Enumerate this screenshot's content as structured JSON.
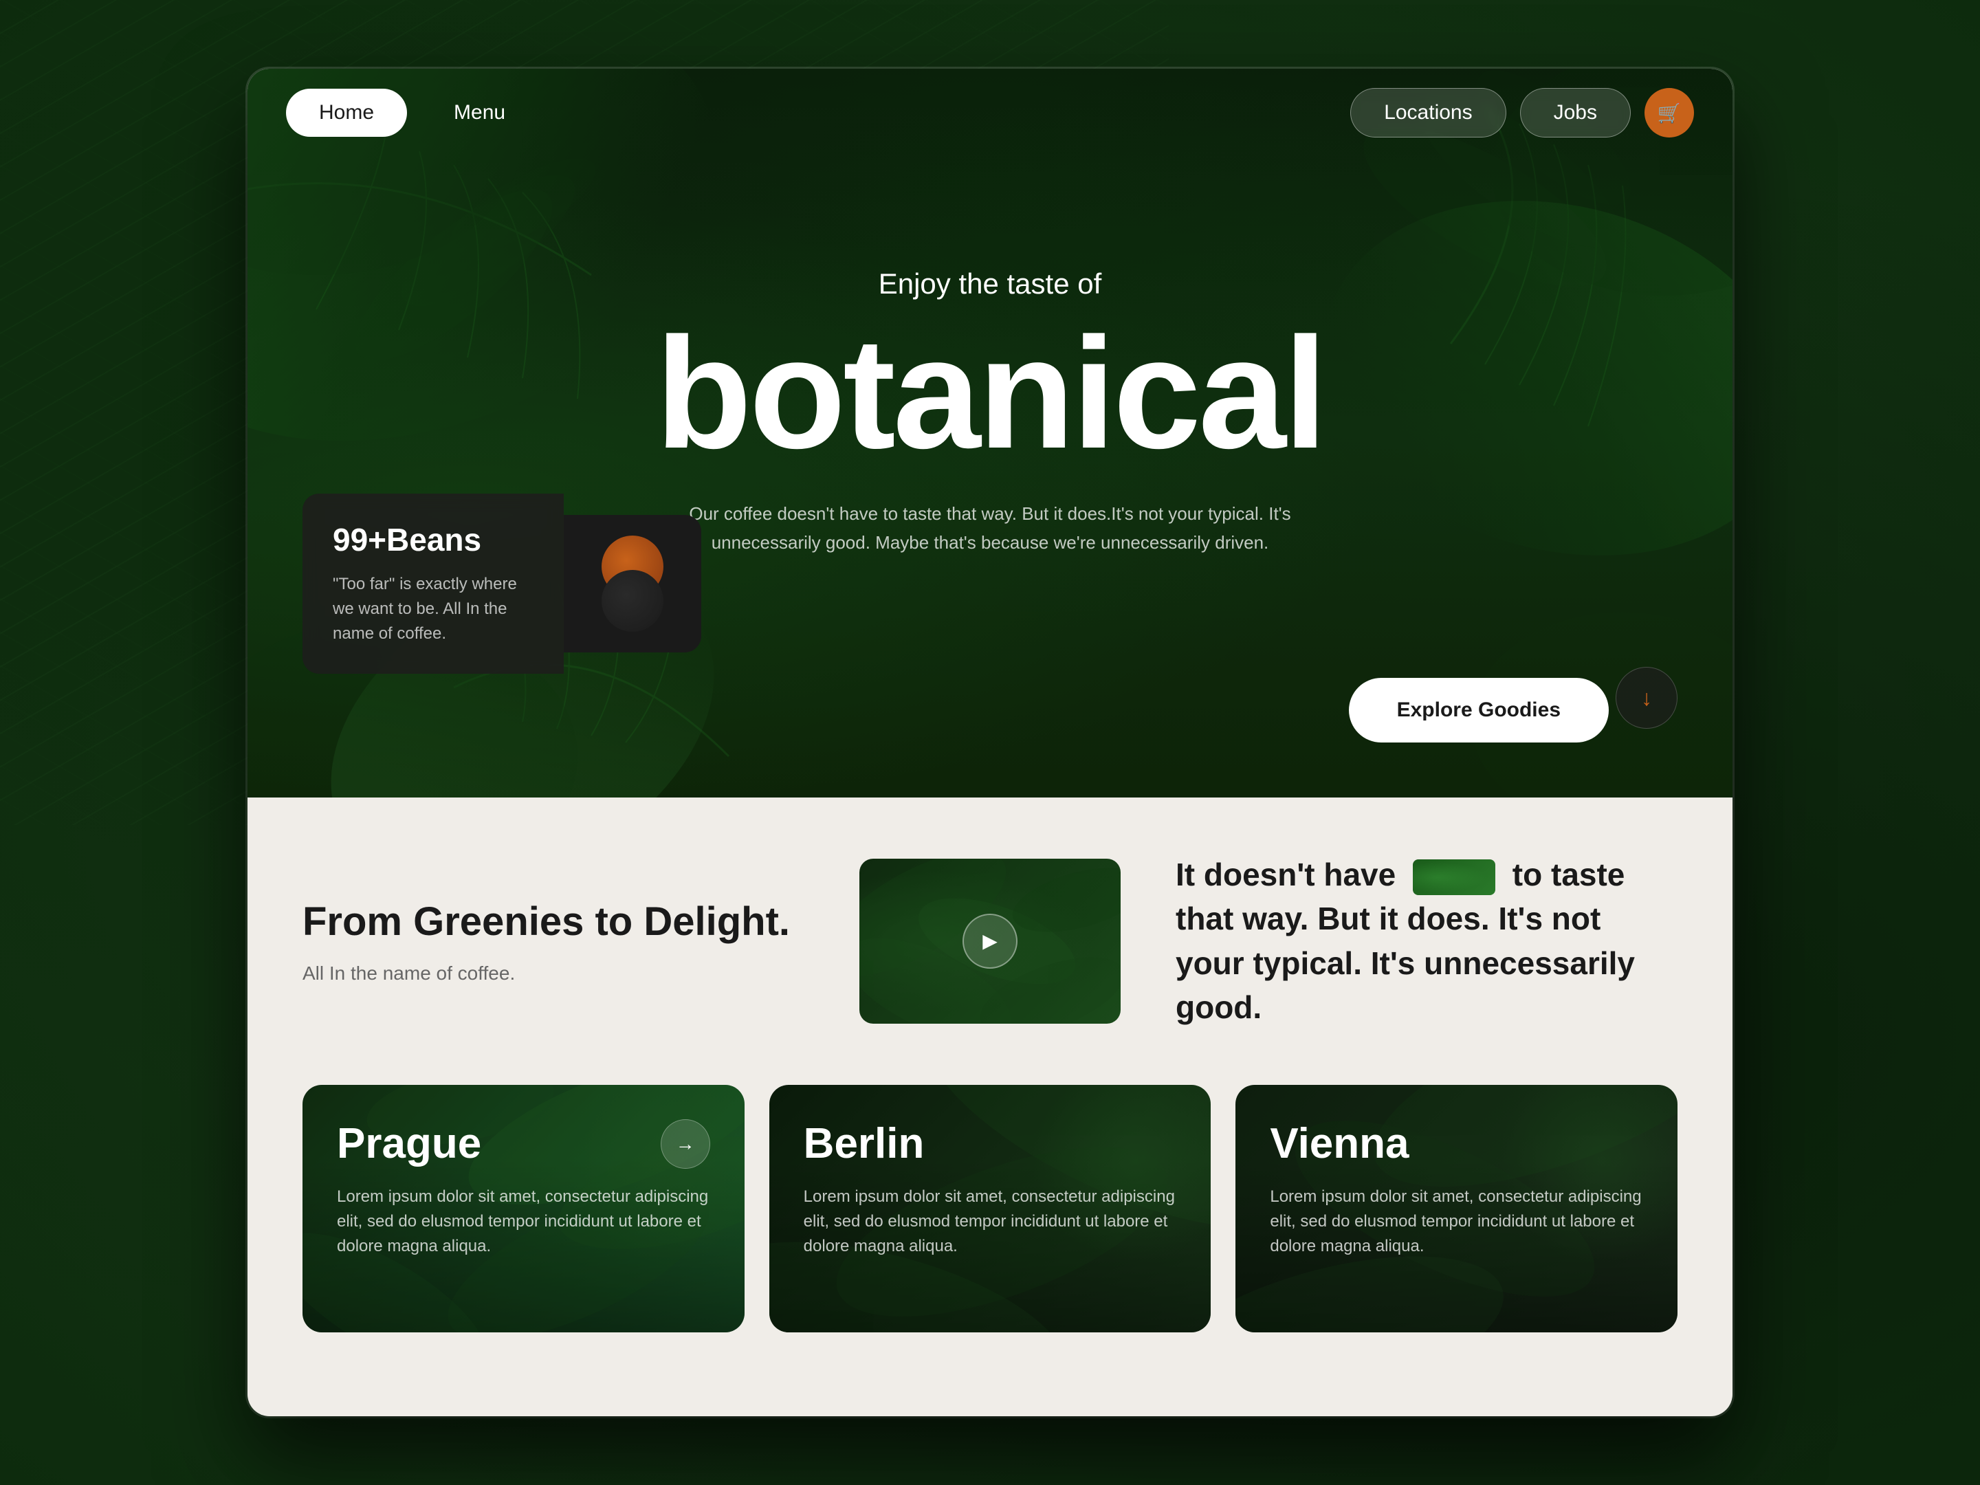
{
  "browser": {
    "background_color": "#1a3a1a"
  },
  "nav": {
    "home_label": "Home",
    "menu_label": "Menu",
    "locations_label": "Locations",
    "jobs_label": "Jobs",
    "cart_icon": "🛒"
  },
  "hero": {
    "subtitle": "Enjoy the taste of",
    "title": "botanical",
    "description": "Our coffee doesn't have to taste that way. But it does.It's not your typical. It's unnecessarily good. Maybe that's because we're unnecessarily driven.",
    "scroll_icon": "↓",
    "explore_label": "Explore Goodies"
  },
  "beans_card": {
    "number": "99+Beans",
    "quote": "\"Too far\" is exactly where we want to be. All In the name of coffee."
  },
  "section_left": {
    "title": "From Greenies to Delight.",
    "subtitle": "All In the name of coffee."
  },
  "section_right": {
    "text_before": "It doesn't have",
    "text_after": "to taste that way. But it does. It's not your typical. It's unnecessarily good."
  },
  "cities": [
    {
      "name": "Prague",
      "description": "Lorem ipsum dolor sit amet, consectetur adipiscing elit, sed do elusmod tempor incididunt ut labore et dolore magna aliqua."
    },
    {
      "name": "Berlin",
      "description": "Lorem ipsum dolor sit amet, consectetur adipiscing elit, sed do elusmod tempor incididunt ut labore et dolore magna aliqua."
    },
    {
      "name": "Vienna",
      "description": "Lorem ipsum dolor sit amet, consectetur adipiscing elit, sed do elusmod tempor incididunt ut labore et dolore magna aliqua."
    }
  ]
}
